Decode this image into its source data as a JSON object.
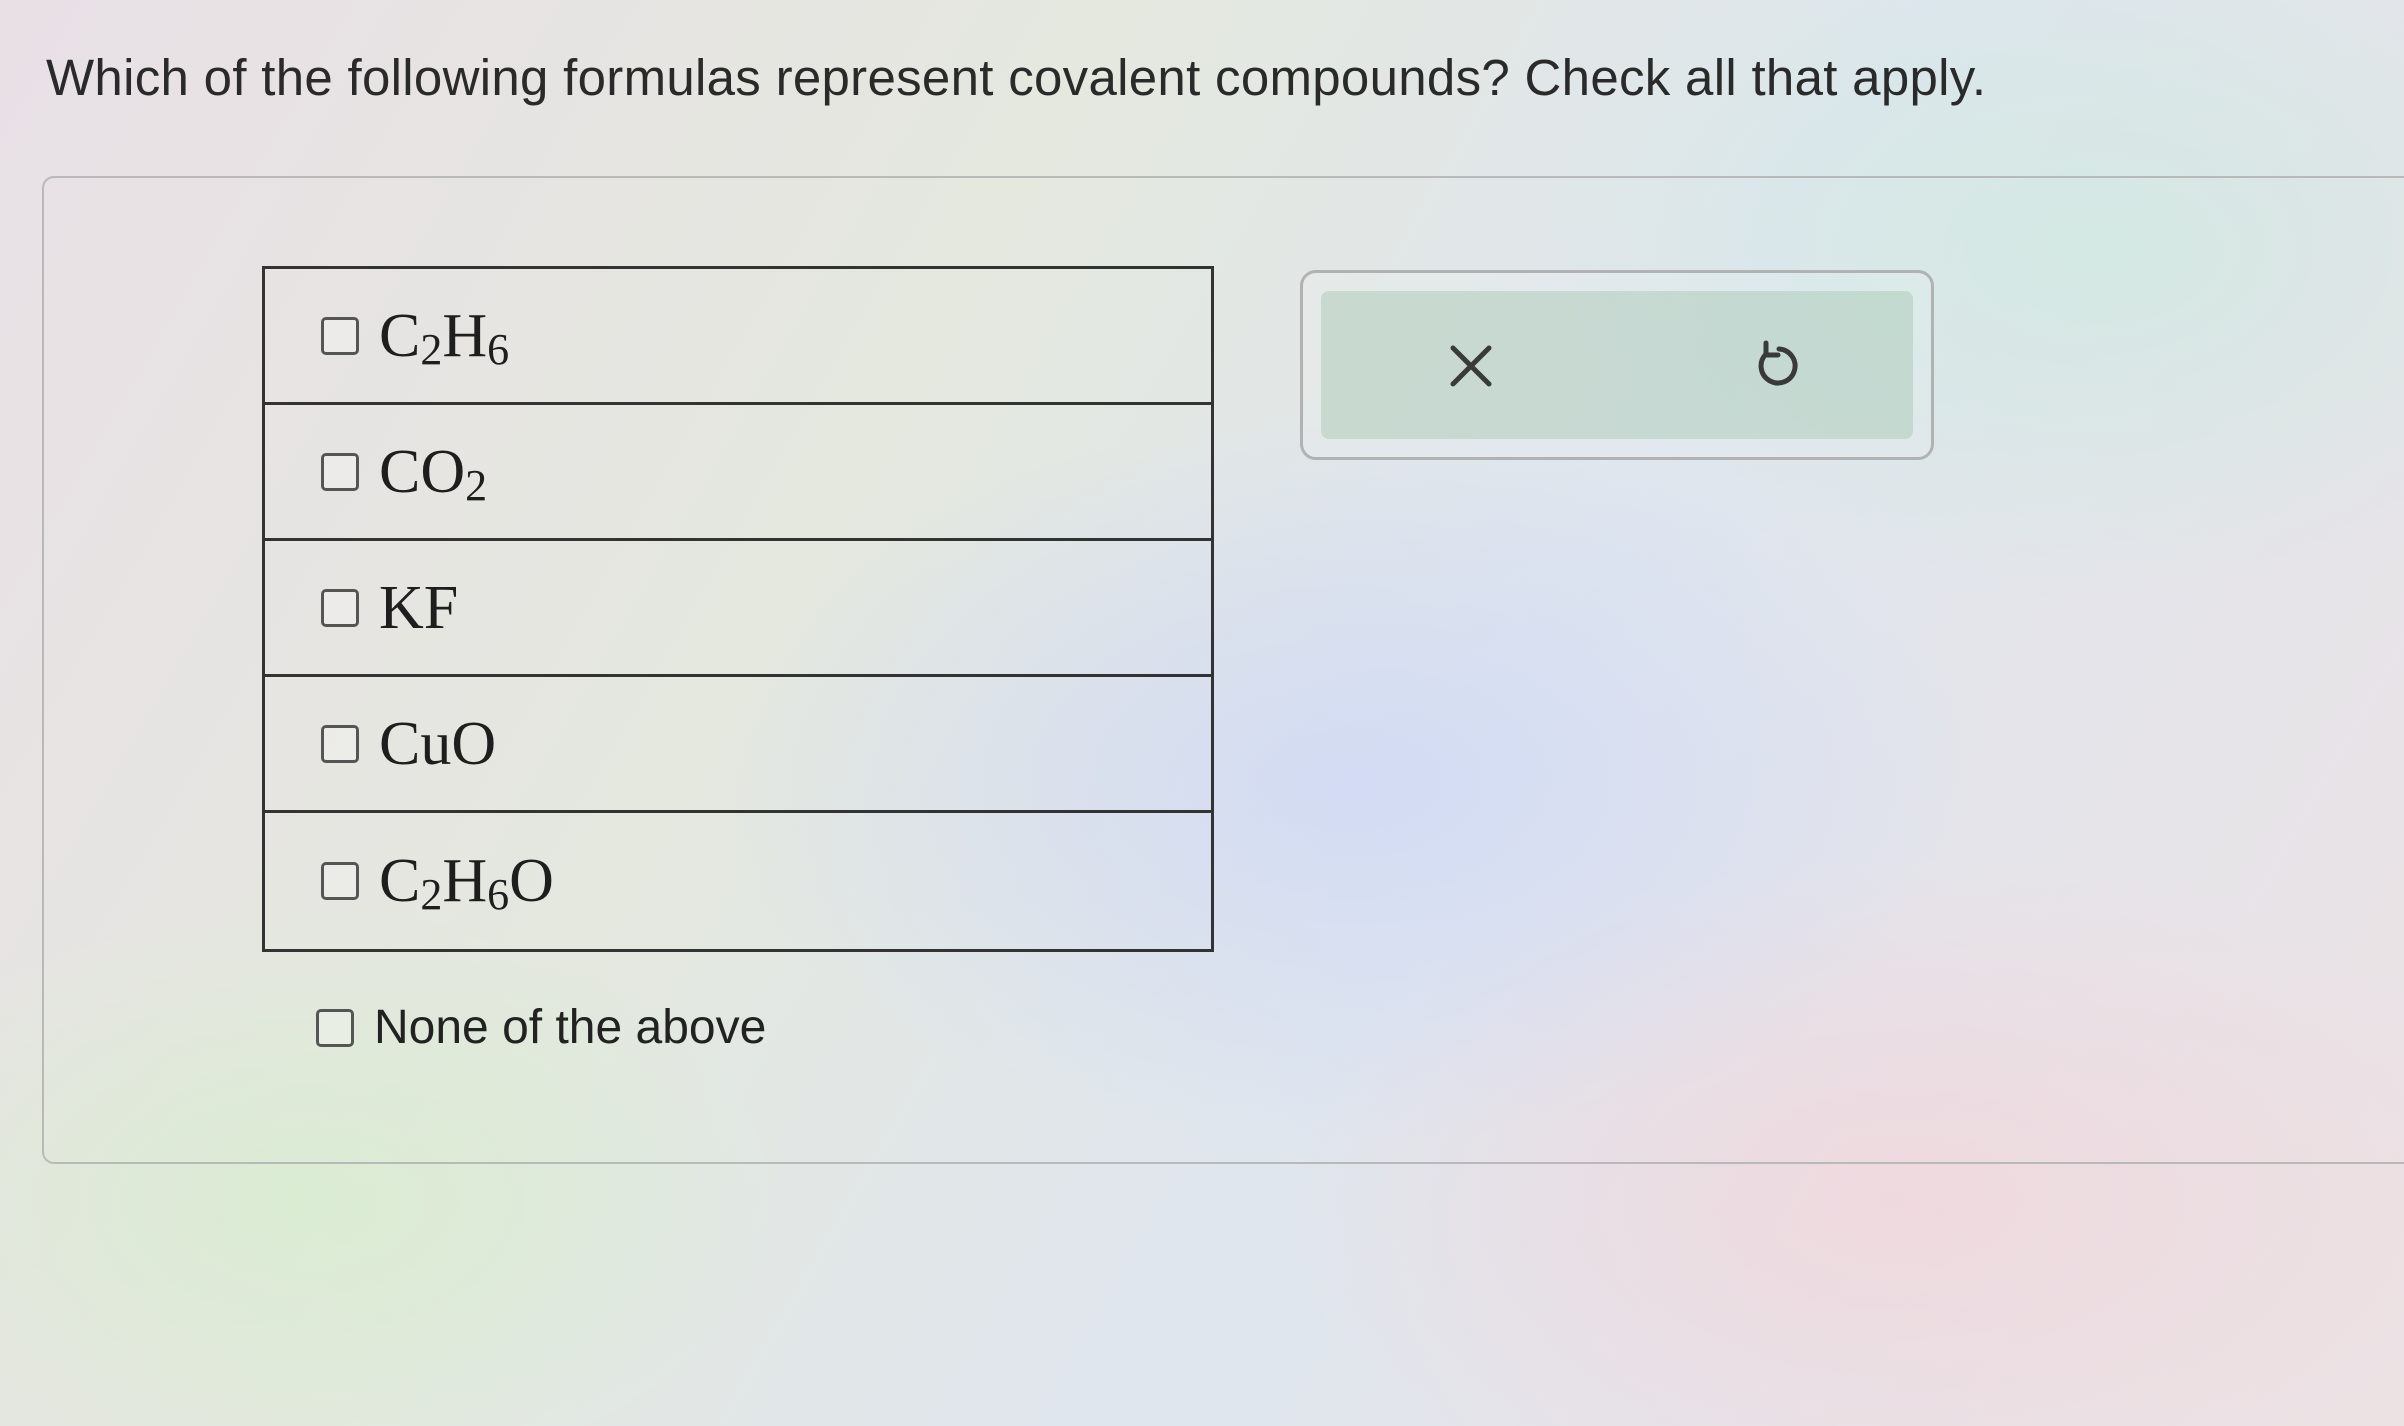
{
  "question": {
    "text": "Which of the following formulas represent covalent compounds? Check all that apply."
  },
  "choices": [
    {
      "parts": [
        {
          "t": "C",
          "sub": false
        },
        {
          "t": "2",
          "sub": true
        },
        {
          "t": "H",
          "sub": false
        },
        {
          "t": "6",
          "sub": true
        }
      ],
      "checked": false
    },
    {
      "parts": [
        {
          "t": "CO",
          "sub": false
        },
        {
          "t": "2",
          "sub": true
        }
      ],
      "checked": false
    },
    {
      "parts": [
        {
          "t": "KF",
          "sub": false
        }
      ],
      "checked": false
    },
    {
      "parts": [
        {
          "t": "CuO",
          "sub": false
        }
      ],
      "checked": false
    },
    {
      "parts": [
        {
          "t": "C",
          "sub": false
        },
        {
          "t": "2",
          "sub": true
        },
        {
          "t": "H",
          "sub": false
        },
        {
          "t": "6",
          "sub": true
        },
        {
          "t": "O",
          "sub": false
        }
      ],
      "checked": false
    }
  ],
  "none_option": {
    "label": "None of the above",
    "checked": false
  },
  "tools": {
    "clear_icon": "x-icon",
    "undo_icon": "undo-icon"
  },
  "colors": {
    "text": "#2a2a2a",
    "table_border": "#333333",
    "panel_border": "#b9b9b9",
    "tool_fill": "#96bea0"
  }
}
